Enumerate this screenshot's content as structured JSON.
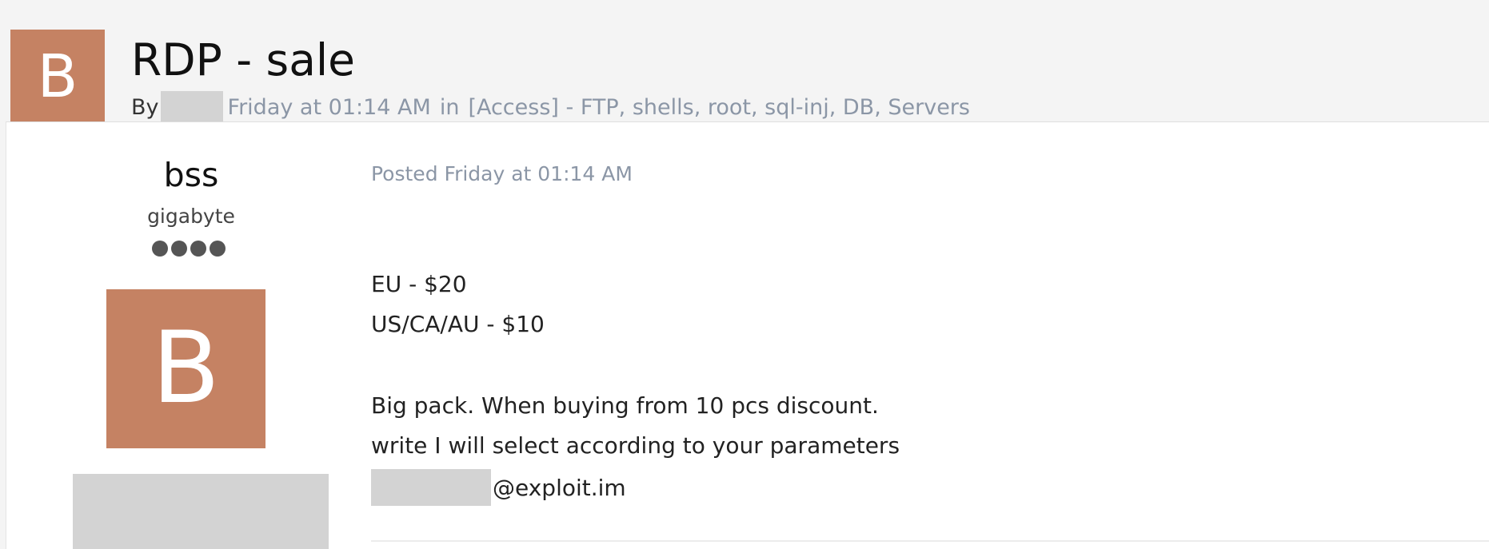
{
  "topic": {
    "avatar_letter": "B",
    "title": "RDP - sale",
    "meta": {
      "by_label": "By",
      "date": "Friday at 01:14 AM",
      "in_label": "in",
      "forum": "[Access] - FTP, shells, root, sql-inj, DB, Servers"
    }
  },
  "post": {
    "author": {
      "name": "bss",
      "rank": "gigabyte",
      "rank_pips": 4,
      "avatar_letter": "B"
    },
    "posted": "Posted Friday at 01:14 AM",
    "body": {
      "line1": "EU - $20",
      "line2": "US/CA/AU - $10",
      "line3": "Big pack. When buying from 10 pcs discount.",
      "line4": "write I will select according to your parameters",
      "email_suffix": "@exploit.im"
    }
  },
  "colors": {
    "avatar_bg": "#c58263",
    "meta_text": "#8b96a6",
    "redaction": "#d3d3d3"
  }
}
